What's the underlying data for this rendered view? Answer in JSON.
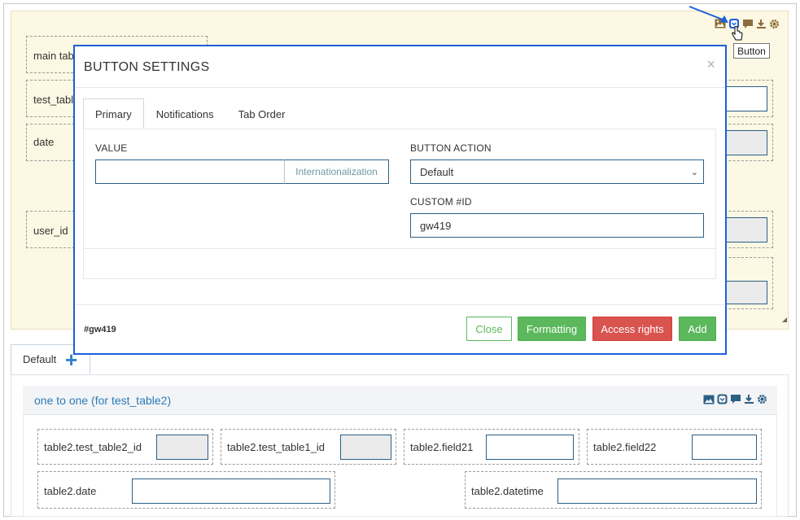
{
  "toolbar": {
    "icons": [
      "image-icon",
      "button-icon",
      "comment-icon",
      "download-icon",
      "gear-icon"
    ],
    "tooltip": "Button",
    "accent": "#8a6d3b"
  },
  "background_fields": [
    {
      "label": "main table"
    },
    {
      "label": "test_table"
    },
    {
      "label": "date"
    },
    {
      "label": "user_id"
    }
  ],
  "modal": {
    "title": "BUTTON SETTINGS",
    "close_glyph": "×",
    "tabs": [
      "Primary",
      "Notifications",
      "Tab Order"
    ],
    "active_tab": "Primary",
    "value_label": "VALUE",
    "value": "",
    "internationalization_label": "Internationalization",
    "button_action_label": "BUTTON ACTION",
    "button_action_value": "Default",
    "custom_id_label": "CUSTOM #ID",
    "custom_id_value": "gw419",
    "footer_id": "#gw419",
    "buttons": {
      "close": "Close",
      "formatting": "Formatting",
      "access_rights": "Access rights",
      "add": "Add"
    },
    "border_color": "#1e5fd9"
  },
  "tabs_bottom": {
    "default_label": "Default",
    "add_glyph": "+"
  },
  "section": {
    "title": "one to one (for test_table2)",
    "fields_row1": [
      {
        "label": "table2.test_table2_id"
      },
      {
        "label": "table2.test_table1_id"
      },
      {
        "label": "table2.field21"
      },
      {
        "label": "table2.field22"
      }
    ],
    "fields_row2": [
      {
        "label": "table2.date"
      },
      {
        "label": "table2.datetime"
      }
    ]
  }
}
